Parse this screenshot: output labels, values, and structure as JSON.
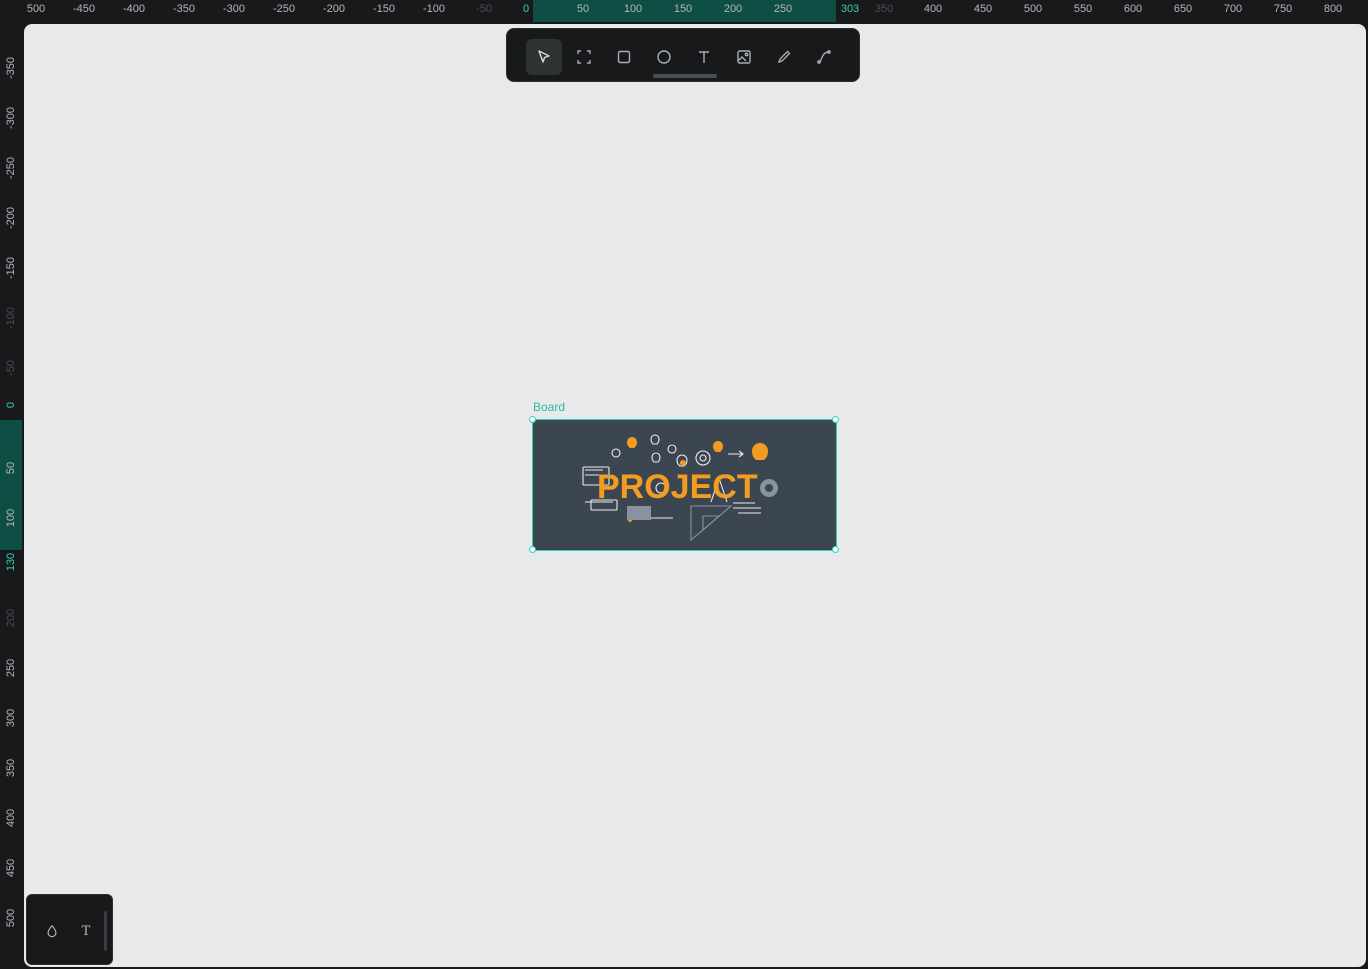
{
  "ruler_top": {
    "labels": [
      "500",
      "-450",
      "-400",
      "-350",
      "-300",
      "-250",
      "-200",
      "-150",
      "-100",
      "-50",
      "0",
      "50",
      "100",
      "150",
      "200",
      "250",
      "303",
      "350",
      "400",
      "450",
      "500",
      "550",
      "600",
      "650",
      "700",
      "750",
      "800"
    ],
    "selection_start": "0",
    "selection_end": "303"
  },
  "ruler_left": {
    "labels": [
      "-350",
      "-300",
      "-250",
      "-200",
      "-150",
      "-100",
      "-50",
      "0",
      "50",
      "100",
      "130",
      "200",
      "250",
      "300",
      "350",
      "400",
      "450",
      "500"
    ]
  },
  "toolbar": {
    "tools": [
      {
        "name": "move-tool",
        "icon": "pointer-icon",
        "active": true
      },
      {
        "name": "board-tool",
        "icon": "board-frame-icon",
        "active": false
      },
      {
        "name": "rectangle-tool",
        "icon": "rectangle-icon",
        "active": false
      },
      {
        "name": "ellipse-tool",
        "icon": "ellipse-icon",
        "active": false
      },
      {
        "name": "text-tool",
        "icon": "text-icon",
        "active": false
      },
      {
        "name": "image-tool",
        "icon": "image-icon",
        "active": false
      },
      {
        "name": "pencil-tool",
        "icon": "pencil-icon",
        "active": false
      },
      {
        "name": "path-tool",
        "icon": "path-icon",
        "active": false
      }
    ]
  },
  "board": {
    "label": "Board",
    "image_text": "PROJECT",
    "background": "#3b4651",
    "accent": "#f39c22"
  },
  "bottom_panel": {
    "color_icon": "drop-icon",
    "text_icon": "text-icon",
    "text_glyph": "T"
  },
  "colors": {
    "selection": "#2ed3b7",
    "canvas": "#e8e9eb",
    "chrome": "#18191b"
  }
}
